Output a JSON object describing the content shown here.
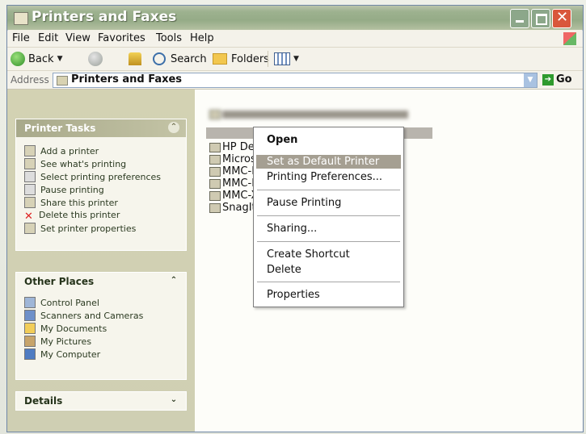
{
  "window": {
    "title": "Printers and Faxes"
  },
  "menu": [
    "File",
    "Edit",
    "View",
    "Favorites",
    "Tools",
    "Help"
  ],
  "toolbar": {
    "back": "Back",
    "search": "Search",
    "folders": "Folders"
  },
  "address": {
    "label": "Address",
    "value": "Printers and Faxes",
    "go": "Go"
  },
  "printer_tasks": {
    "title": "Printer Tasks",
    "items": [
      "Add a printer",
      "See what's printing",
      "Select printing preferences",
      "Pause printing",
      "Share this printer",
      "Delete this printer",
      "Set printer properties"
    ]
  },
  "other_places": {
    "title": "Other Places",
    "items": [
      "Control Panel",
      "Scanners and Cameras",
      "My Documents",
      "My Pictures",
      "My Computer"
    ]
  },
  "details": {
    "title": "Details"
  },
  "files": [
    "HP Des",
    "Microsc",
    "MMC-II",
    "MMC-P",
    "MMC-X",
    "SnagIt"
  ],
  "context_menu": {
    "open": "Open",
    "set_default": "Set as Default Printer",
    "printing_preferences": "Printing Preferences...",
    "pause_printing": "Pause Printing",
    "sharing": "Sharing...",
    "create_shortcut": "Create Shortcut",
    "delete": "Delete",
    "properties": "Properties"
  }
}
